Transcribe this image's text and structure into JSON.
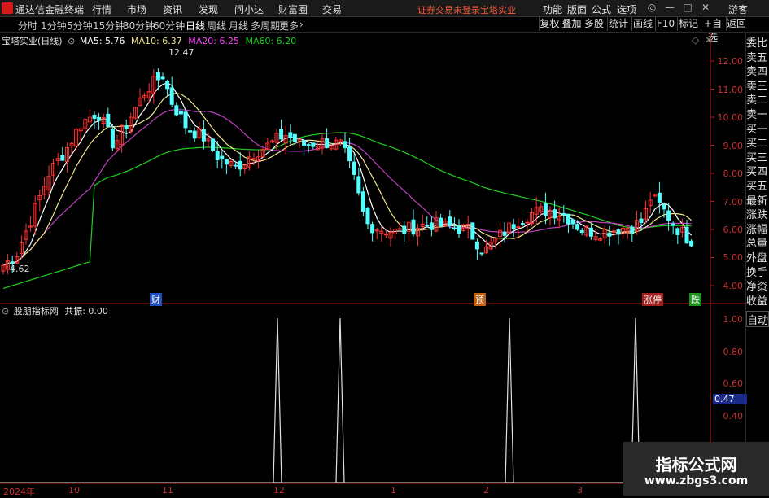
{
  "menubar": {
    "app_title": "通达信金融终端",
    "items": [
      "行情",
      "市场",
      "资讯",
      "发现",
      "问小达",
      "财富圈",
      "交易"
    ],
    "warning": "证券交易未登录",
    "stock": "宝塔实业",
    "right_items": [
      "功能",
      "版面",
      "公式",
      "选项"
    ],
    "guest": "游客"
  },
  "periods": [
    "分时",
    "1分钟",
    "5分钟",
    "15分钟",
    "30分钟",
    "60分钟",
    "日线",
    "周线",
    "月线",
    "多周期",
    "更多"
  ],
  "active_period": "日线",
  "toolbar": [
    "复权",
    "叠加",
    "多股",
    "统计",
    "画线",
    "F10",
    "标记",
    "+自选",
    "返回"
  ],
  "main_pane": {
    "title": "宝塔实业(日线)",
    "ma": [
      {
        "label": "MA5: 5.76",
        "color": "#ffffff"
      },
      {
        "label": "MA10: 6.37",
        "color": "#f0e68c"
      },
      {
        "label": "MA20: 6.25",
        "color": "#ff40ff"
      },
      {
        "label": "MA60: 6.20",
        "color": "#20d020"
      }
    ],
    "high_label": "12.47",
    "low_label": "4.62",
    "yticks": [
      "12.00",
      "11.00",
      "10.00",
      "9.00",
      "8.00",
      "7.00",
      "6.00",
      "5.00",
      "4.00"
    ],
    "events": [
      "财",
      "预",
      "涨停",
      "跌"
    ]
  },
  "order_panel": [
    "委比",
    "卖五",
    "卖四",
    "卖三",
    "卖二",
    "卖一",
    "买一",
    "买二",
    "买三",
    "买四",
    "买五",
    "最新",
    "涨跌",
    "涨幅",
    "总量",
    "外盘",
    "换手",
    "净资",
    "收益"
  ],
  "indicator_pane": {
    "title": "股朋指标网",
    "value_label": "共振: 0.00",
    "yticks": [
      "1.00",
      "0.80",
      "0.60",
      "0.40"
    ],
    "current": "0.47",
    "auto": "自动"
  },
  "xaxis": [
    "2024年",
    "10",
    "11",
    "12",
    "1",
    "2",
    "3"
  ],
  "watermark": {
    "title": "指标公式网",
    "url": "www.zbgs3.com"
  },
  "colors": {
    "up": "#ff3232",
    "down": "#54ffff",
    "axis": "#b41e1e",
    "bg": "#000000"
  }
}
